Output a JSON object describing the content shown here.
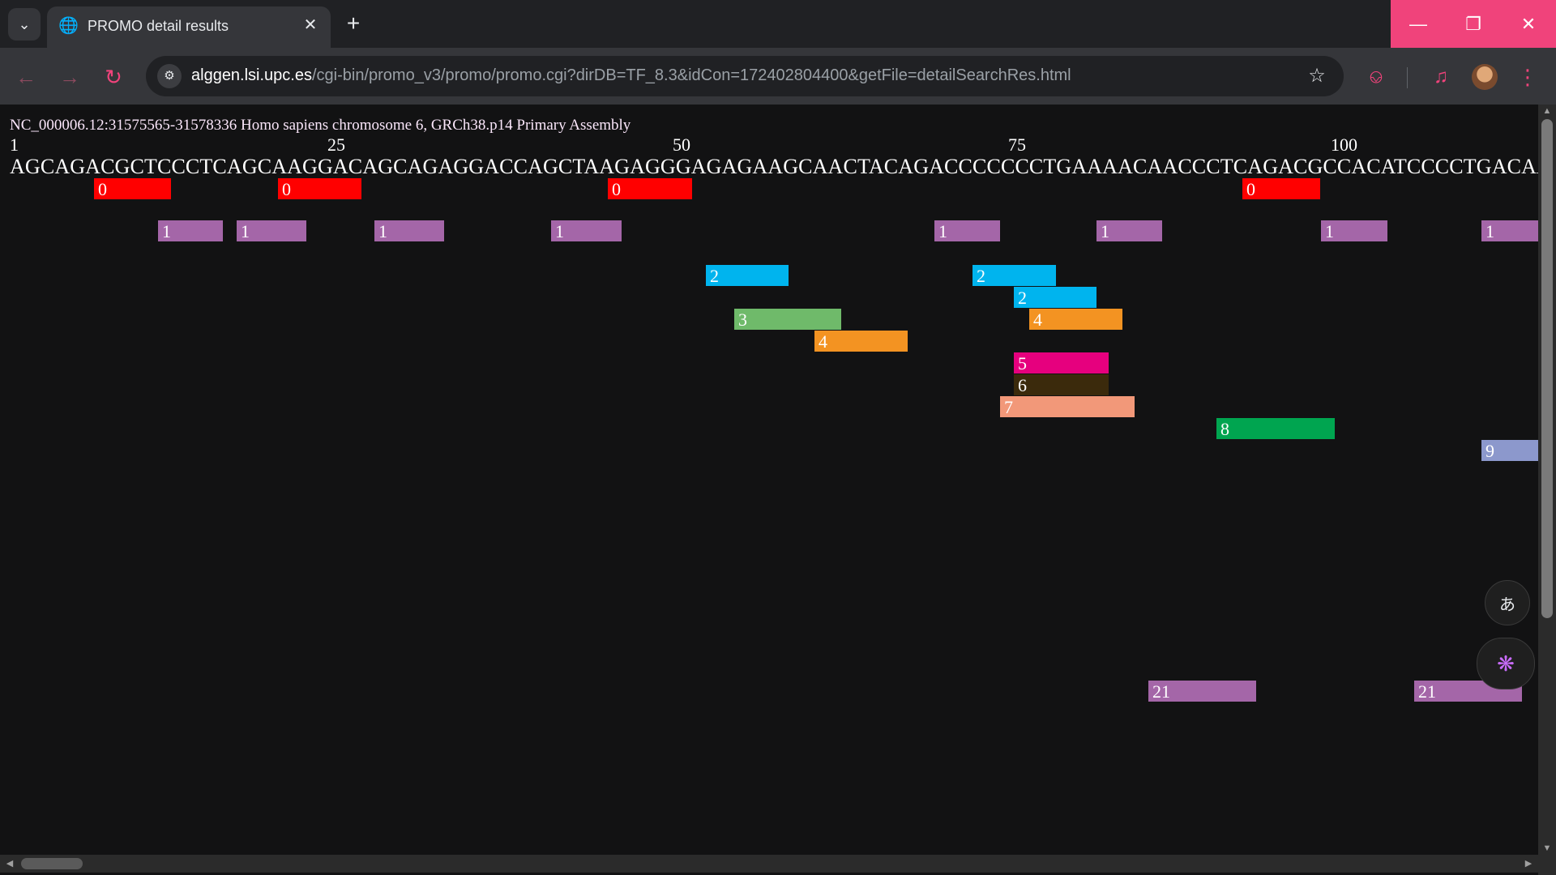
{
  "tab": {
    "title": "PROMO detail results"
  },
  "omnibox": {
    "host": "alggen.lsi.upc.es",
    "path": "/cgi-bin/promo_v3/promo/promo.cgi?dirDB=TF_8.3&idCon=172402804400&getFile=detailSearchRes.html"
  },
  "sequence": {
    "title": "NC_000006.12:31575565-31578336 Homo sapiens chromosome 6, GRCh38.p14 Primary Assembly",
    "ruler": [
      "1",
      "25",
      "50",
      "75",
      "100"
    ],
    "bases": "AGCAGACGCTCCCTCAGCAAGGACAGCAGAGGACCAGCTAAGAGGGAGAGAAGCAACTACAGACCCCCCCTGAAAACAACCCTCAGACGCCACATCCCCTGACAAGCTGCCAG"
  },
  "factor_colors": {
    "0": "#ff0000",
    "1": "#a466a8",
    "2": "#00b4ee",
    "3": "#6fba6a",
    "4": "#f39322",
    "5": "#e6007e",
    "6": "#3b2a0c",
    "7": "#f29879",
    "8": "#00a550",
    "9": "#8c98cc",
    "21": "#a466a8"
  },
  "binding_sites": [
    {
      "factor": "0"
    },
    {
      "factor": "0"
    },
    {
      "factor": "0"
    },
    {
      "factor": "0"
    },
    {
      "factor": "1"
    },
    {
      "factor": "1"
    },
    {
      "factor": "1"
    },
    {
      "factor": "1"
    },
    {
      "factor": "1"
    },
    {
      "factor": "1"
    },
    {
      "factor": "1"
    },
    {
      "factor": "1"
    },
    {
      "factor": "2"
    },
    {
      "factor": "2"
    },
    {
      "factor": "2"
    },
    {
      "factor": "3"
    },
    {
      "factor": "4"
    },
    {
      "factor": "4"
    },
    {
      "factor": "5"
    },
    {
      "factor": "6"
    },
    {
      "factor": "7"
    },
    {
      "factor": "8"
    },
    {
      "factor": "9"
    },
    {
      "factor": "21"
    },
    {
      "factor": "21"
    }
  ]
}
